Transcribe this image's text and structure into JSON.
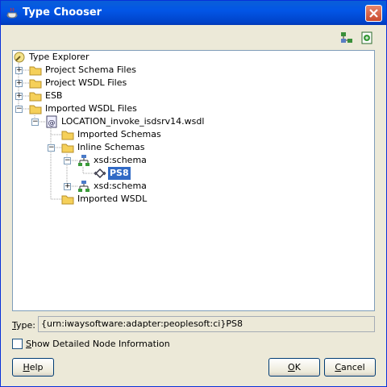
{
  "window": {
    "title": "Type Chooser"
  },
  "toolbar": {
    "buttons": [
      {
        "icon": "hierarchy-view-icon"
      },
      {
        "icon": "import-schema-icon"
      }
    ]
  },
  "tree": {
    "root": "Type Explorer",
    "n1": "Project Schema Files",
    "n2": "Project WSDL Files",
    "n3": "ESB",
    "n4": "Imported WSDL Files",
    "n5": "LOCATION_invoke_isdsrv14.wsdl",
    "n6": "Imported Schemas",
    "n7": "Inline Schemas",
    "n8": "xsd:schema",
    "n9": "PS8",
    "n10": "xsd:schema",
    "n11": "Imported WSDL"
  },
  "type": {
    "label_key": "T",
    "label_rest": "ype:",
    "value": "{urn:iwaysoftware:adapter:peoplesoft:ci}PS8"
  },
  "checkbox": {
    "key": "S",
    "label_rest": "how Detailed Node Information",
    "checked": false
  },
  "buttons": {
    "help_key": "H",
    "help_rest": "elp",
    "ok_key": "O",
    "ok_rest": "K",
    "cancel_key": "C",
    "cancel_rest": "ancel"
  }
}
